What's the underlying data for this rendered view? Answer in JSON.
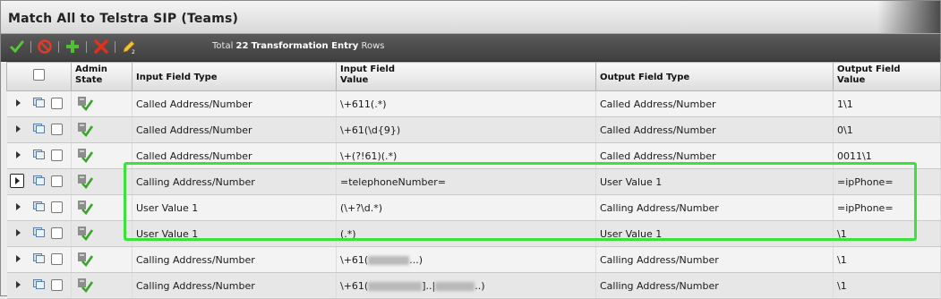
{
  "window": {
    "title": "Match All to Telstra SIP (Teams)"
  },
  "toolbar": {
    "icons": [
      "checkmark-icon",
      "disable-icon",
      "add-icon",
      "delete-icon",
      "edit-icon"
    ],
    "summary_prefix": "Total",
    "summary_count": "22",
    "summary_label": "Transformation Entry",
    "summary_suffix": "Rows"
  },
  "table": {
    "headers": {
      "admin_state_1": "Admin",
      "admin_state_2": "State",
      "input_type": "Input Field Type",
      "input_value_1": "Input Field",
      "input_value_2": "Value",
      "output_type": "Output Field Type",
      "output_value_1": "Output Field",
      "output_value_2": "Value"
    },
    "rows": [
      {
        "input_type": "Called Address/Number",
        "input_value": "\\+611(.*)",
        "output_type": "Called Address/Number",
        "output_value": "1\\1"
      },
      {
        "input_type": "Called Address/Number",
        "input_value": "\\+61(\\d{9})",
        "output_type": "Called Address/Number",
        "output_value": "0\\1"
      },
      {
        "input_type": "Called Address/Number",
        "input_value": "\\+(?!61)(.*)",
        "output_type": "Called Address/Number",
        "output_value": "0011\\1"
      },
      {
        "input_type": "Calling Address/Number",
        "input_value": "=telephoneNumber=",
        "output_type": "User Value 1",
        "output_value": "=ipPhone="
      },
      {
        "input_type": "User Value 1",
        "input_value": "(\\+?\\d.*)",
        "output_type": "Calling Address/Number",
        "output_value": "=ipPhone="
      },
      {
        "input_type": "User Value 1",
        "input_value": "(.*)",
        "output_type": "User Value 1",
        "output_value": "\\1"
      },
      {
        "input_type": "Calling Address/Number",
        "input_value_pre": "\\+61(",
        "input_value_post": "...)",
        "output_type": "Calling Address/Number",
        "output_value": "\\1"
      },
      {
        "input_type": "Calling Address/Number",
        "input_value_pre": "\\+61(",
        "input_value_mid": "]..|",
        "input_value_post": "..)",
        "output_type": "Calling Address/Number",
        "output_value": "\\1"
      }
    ]
  },
  "colors": {
    "highlight": "#39e33a",
    "toolbar": "#4a4a4a",
    "ok_green": "#3aa52a"
  }
}
